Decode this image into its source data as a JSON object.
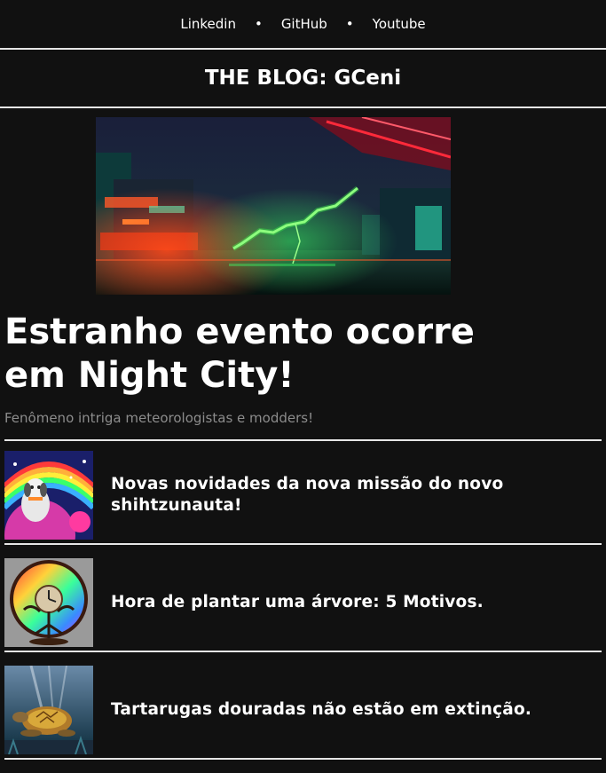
{
  "nav": {
    "links": [
      "Linkedin",
      "GitHub",
      "Youtube"
    ],
    "separator": "•"
  },
  "blog": {
    "title": "THE BLOG: GCeni"
  },
  "featured": {
    "image_alt": "Cyberpunk city with green lightning",
    "headline": "Estranho evento ocorre em Night City!",
    "subheadline": "Fenômeno intriga meteorologistas e modders!"
  },
  "articles": [
    {
      "title": "Novas novidades da nova missão do novo shihtzunauta!",
      "thumb": "shihtzu-astronaut-image"
    },
    {
      "title": "Hora de plantar uma árvore: 5 Motivos.",
      "thumb": "tree-clock-image"
    },
    {
      "title": "Tartarugas douradas não estão em extinção.",
      "thumb": "golden-turtle-image"
    }
  ],
  "colors": {
    "background": "#111111",
    "text": "#ffffff",
    "muted": "#8c8c8c",
    "divider": "#e6e6e6"
  }
}
